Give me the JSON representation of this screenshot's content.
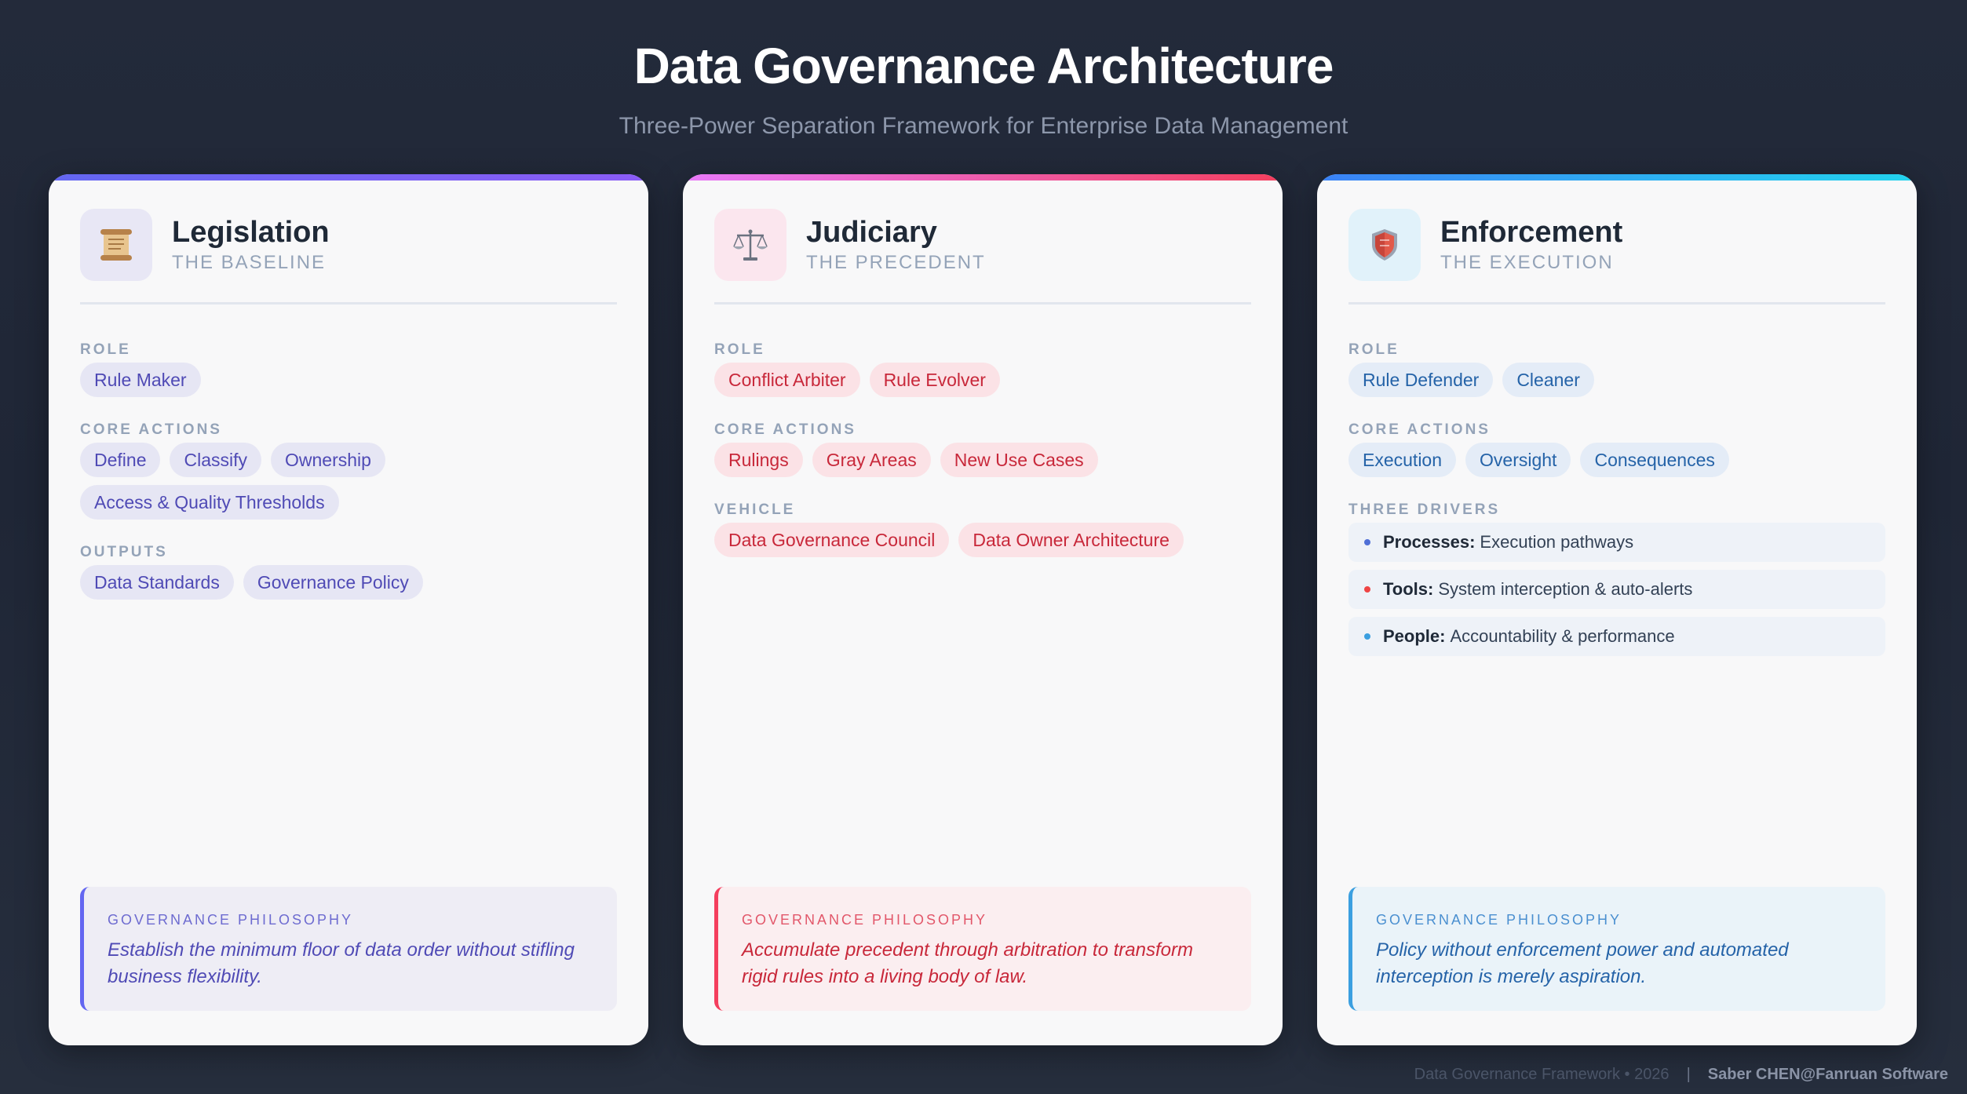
{
  "header": {
    "title": "Data Governance Architecture",
    "subtitle": "Three-Power Separation Framework for Enterprise Data Management"
  },
  "cards": [
    {
      "name": "Legislation",
      "tag": "THE BASELINE",
      "icon": "scroll-icon",
      "accent": "#6366f1",
      "sections": [
        {
          "label": "ROLE",
          "items": [
            "Rule Maker"
          ]
        },
        {
          "label": "CORE ACTIONS",
          "items": [
            "Define",
            "Classify",
            "Ownership",
            "Access & Quality Thresholds"
          ]
        },
        {
          "label": "OUTPUTS",
          "items": [
            "Data Standards",
            "Governance Policy"
          ]
        }
      ],
      "philosophy_label": "GOVERNANCE PHILOSOPHY",
      "philosophy_text": "Establish the minimum floor of data order without stifling business flexibility."
    },
    {
      "name": "Judiciary",
      "tag": "THE PRECEDENT",
      "icon": "scales-icon",
      "accent": "#f43f5e",
      "sections": [
        {
          "label": "ROLE",
          "items": [
            "Conflict Arbiter",
            "Rule Evolver"
          ]
        },
        {
          "label": "CORE ACTIONS",
          "items": [
            "Rulings",
            "Gray Areas",
            "New Use Cases"
          ]
        },
        {
          "label": "VEHICLE",
          "items": [
            "Data Governance Council",
            "Data Owner Architecture"
          ]
        }
      ],
      "philosophy_label": "GOVERNANCE PHILOSOPHY",
      "philosophy_text": "Accumulate precedent through arbitration to transform rigid rules into a living body of law."
    },
    {
      "name": "Enforcement",
      "tag": "THE EXECUTION",
      "icon": "shield-icon",
      "accent": "#3b82f6",
      "sections": [
        {
          "label": "ROLE",
          "items": [
            "Rule Defender",
            "Cleaner"
          ]
        },
        {
          "label": "CORE ACTIONS",
          "items": [
            "Execution",
            "Oversight",
            "Consequences"
          ]
        }
      ],
      "drivers_label": "THREE DRIVERS",
      "drivers": [
        {
          "key": "Processes:",
          "text": "Execution pathways",
          "color": "#4f6fd6"
        },
        {
          "key": "Tools:",
          "text": "System interception & auto-alerts",
          "color": "#ef4444"
        },
        {
          "key": "People:",
          "text": "Accountability & performance",
          "color": "#3b9fe0"
        }
      ],
      "philosophy_label": "GOVERNANCE PHILOSOPHY",
      "philosophy_text": "Policy without enforcement power and automated interception is merely aspiration."
    }
  ],
  "footer": {
    "left": "Data Governance Framework • 2026",
    "separator": "|",
    "author": "Saber CHEN@Fanruan Software"
  }
}
